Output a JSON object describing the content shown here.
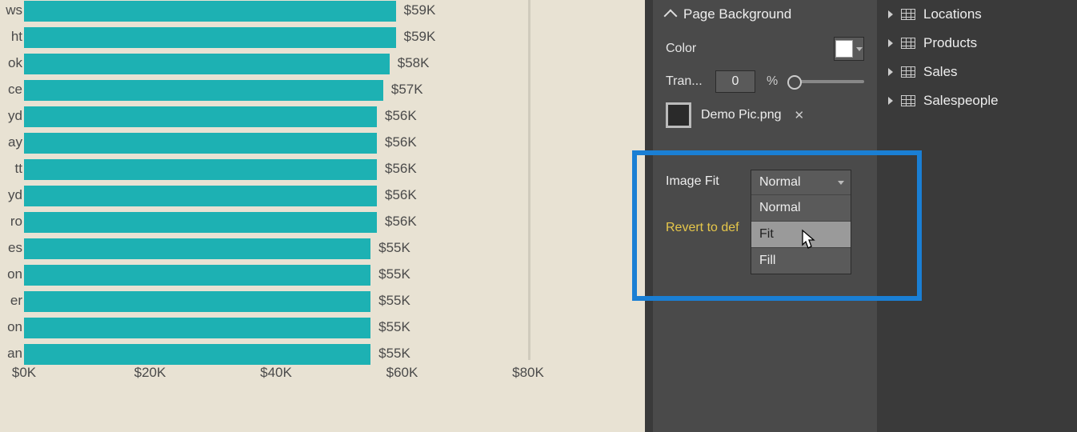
{
  "chart_data": {
    "type": "bar",
    "orientation": "horizontal",
    "unit": "$K",
    "xlabel": "",
    "ylabel": "",
    "xlim": [
      0,
      80
    ],
    "xticks": [
      "$0K",
      "$20K",
      "$40K",
      "$60K",
      "$80K"
    ],
    "categories": [
      "ws",
      "ht",
      "ok",
      "ce",
      "yd",
      "ay",
      "tt",
      "yd",
      "ro",
      "es",
      "on",
      "er",
      "on",
      "an"
    ],
    "values": [
      59,
      59,
      58,
      57,
      56,
      56,
      56,
      56,
      56,
      55,
      55,
      55,
      55,
      55
    ],
    "value_labels": [
      "$59K",
      "$59K",
      "$58K",
      "$57K",
      "$56K",
      "$56K",
      "$56K",
      "$56K",
      "$56K",
      "$55K",
      "$55K",
      "$55K",
      "$55K",
      "$55K"
    ]
  },
  "format": {
    "section": "Page Background",
    "color_label": "Color",
    "color_value": "#ffffff",
    "transparency_label": "Tran...",
    "transparency_value": "0",
    "transparency_unit": "%",
    "image_label": "Demo Pic.png",
    "image_fit_label": "Image Fit",
    "image_fit_selected": "Normal",
    "image_fit_options": [
      "Normal",
      "Fit",
      "Fill"
    ],
    "revert_label": "Revert to def"
  },
  "fields": {
    "items": [
      "Locations",
      "Products",
      "Sales",
      "Salespeople"
    ]
  }
}
